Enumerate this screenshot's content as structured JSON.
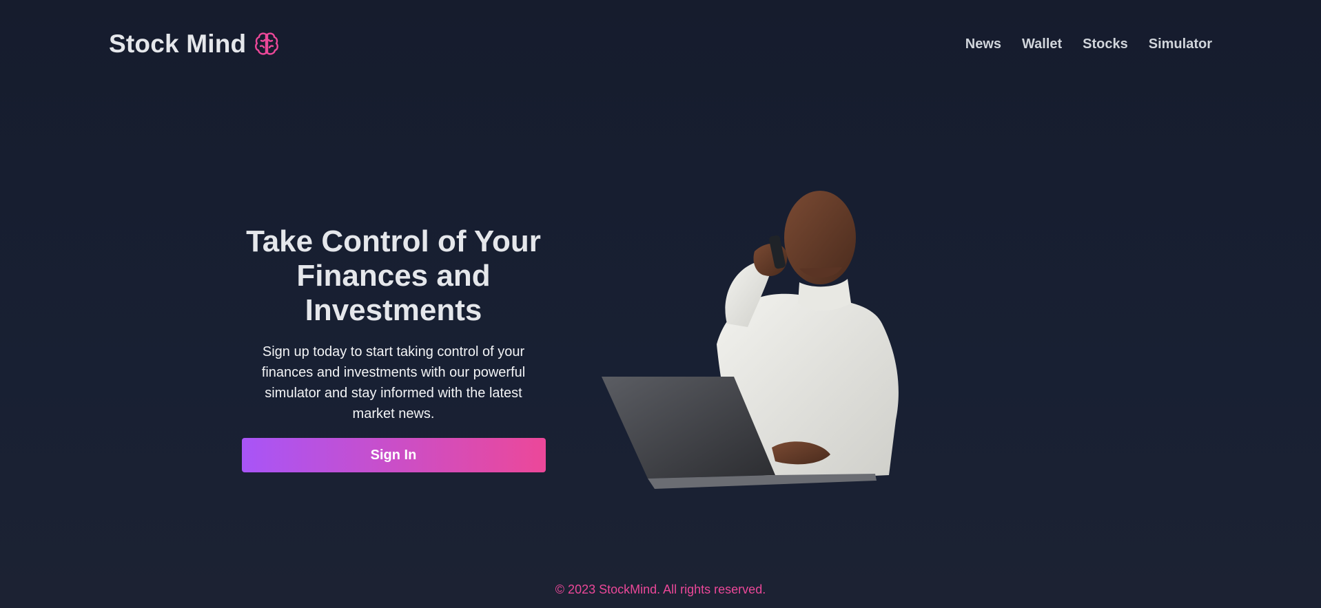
{
  "header": {
    "logo_text": "Stock Mind",
    "logo_icon": "brain-icon",
    "nav": [
      {
        "label": "News"
      },
      {
        "label": "Wallet"
      },
      {
        "label": "Stocks"
      },
      {
        "label": "Simulator"
      }
    ]
  },
  "hero": {
    "title": "Take Control of Your Finances and Investments",
    "subtitle": "Sign up today to start taking control of your finances and investments with our powerful simulator and stay informed with the latest market news.",
    "cta_label": "Sign In",
    "image_subject": "man-on-phone-with-laptop"
  },
  "footer": {
    "copyright": "© 2023 StockMind. All rights reserved."
  },
  "colors": {
    "background": "#161c2d",
    "accent_pink": "#ec4899",
    "accent_purple": "#a855f7",
    "text_primary": "#e5e7eb"
  }
}
